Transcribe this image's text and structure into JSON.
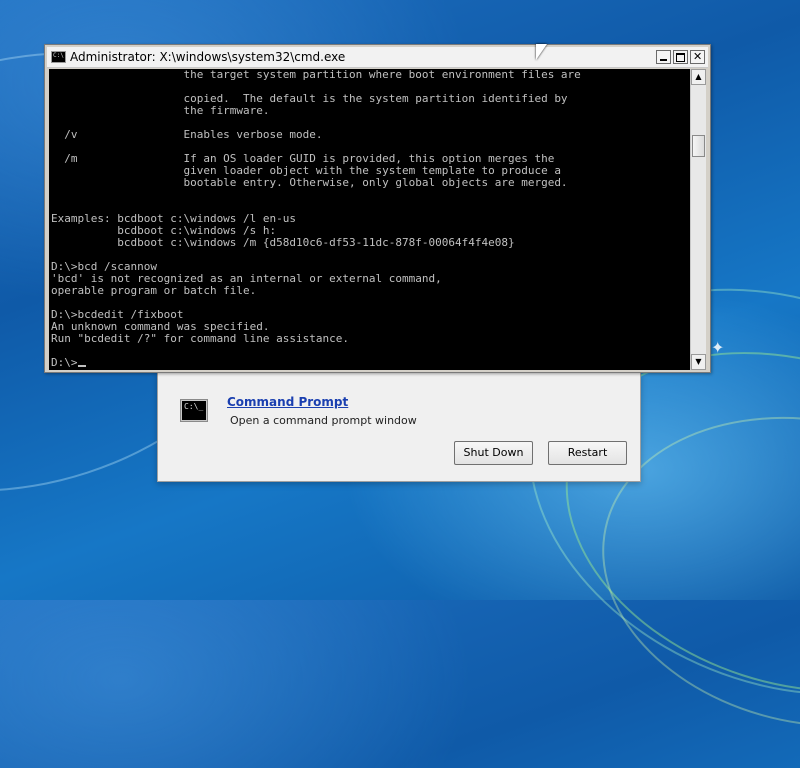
{
  "cmd_window": {
    "title": "Administrator: X:\\windows\\system32\\cmd.exe",
    "console_lines": [
      "                    the target system partition where boot environment files are",
      "",
      "                    copied.  The default is the system partition identified by",
      "                    the firmware.",
      "",
      "  /v                Enables verbose mode.",
      "",
      "  /m                If an OS loader GUID is provided, this option merges the",
      "                    given loader object with the system template to produce a",
      "                    bootable entry. Otherwise, only global objects are merged.",
      "",
      "",
      "Examples: bcdboot c:\\windows /l en-us",
      "          bcdboot c:\\windows /s h:",
      "          bcdboot c:\\windows /m {d58d10c6-df53-11dc-878f-00064f4f4e08}",
      "",
      "D:\\>bcd /scannow",
      "'bcd' is not recognized as an internal or external command,",
      "operable program or batch file.",
      "",
      "D:\\>bcdedit /fixboot",
      "An unknown command was specified.",
      "Run \"bcdedit /?\" for command line assistance.",
      ""
    ],
    "prompt": "D:\\>",
    "icon_glyph": "C:\\"
  },
  "recovery_dialog": {
    "link_label": "Command Prompt",
    "description": "Open a command prompt window",
    "icon_glyph": "C:\\_",
    "shutdown_label": "Shut Down",
    "restart_label": "Restart"
  },
  "icons": {
    "titlebar": "cmd-icon",
    "minimize": "minimize-icon",
    "maximize": "maximize-icon",
    "close": "close-icon",
    "scroll_up": "arrow-up-icon",
    "scroll_down": "arrow-down-icon",
    "pointer": "mouse-pointer-icon"
  },
  "colors": {
    "console_bg": "#000000",
    "console_text": "#c0c0c0",
    "link": "#1a3fb0"
  }
}
